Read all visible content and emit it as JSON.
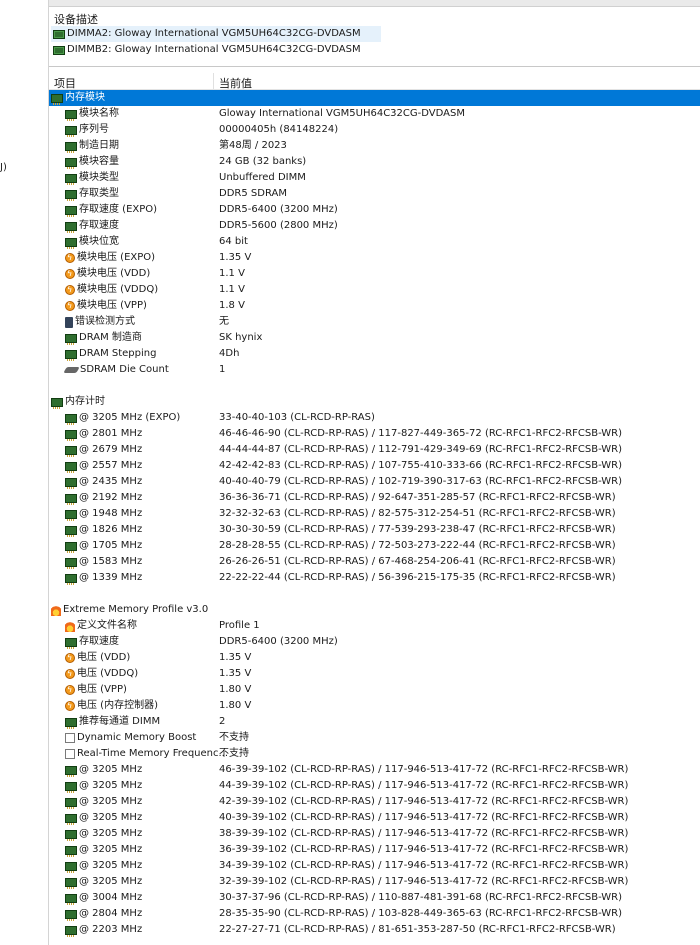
{
  "left_fragment": "J)",
  "device_panel": {
    "title": "设备描述",
    "items": [
      {
        "label": "DIMMA2: Gloway International VGM5UH64C32CG-DVDASM"
      },
      {
        "label": "DIMMB2: Gloway International VGM5UH64C32CG-DVDASM"
      }
    ]
  },
  "columns": {
    "field": "项目",
    "value": "当前值"
  },
  "rows": [
    {
      "group": true,
      "selected": true,
      "icon": "memory-module-icon",
      "label": "内存模块"
    },
    {
      "icon": "memory-module-icon",
      "label": "模块名称",
      "value": "Gloway International VGM5UH64C32CG-DVDASM"
    },
    {
      "icon": "memory-module-icon",
      "label": "序列号",
      "value": "00000405h (84148224)"
    },
    {
      "icon": "memory-module-icon",
      "label": "制造日期",
      "value": "第48周 / 2023"
    },
    {
      "icon": "memory-module-icon",
      "label": "模块容量",
      "value": "24 GB (32 banks)"
    },
    {
      "icon": "memory-module-icon",
      "label": "模块类型",
      "value": "Unbuffered DIMM"
    },
    {
      "icon": "memory-module-icon",
      "label": "存取类型",
      "value": "DDR5 SDRAM"
    },
    {
      "icon": "memory-module-icon",
      "label": "存取速度 (EXPO)",
      "value": "DDR5-6400 (3200 MHz)"
    },
    {
      "icon": "memory-module-icon",
      "label": "存取速度",
      "value": "DDR5-5600 (2800 MHz)"
    },
    {
      "icon": "memory-module-icon",
      "label": "模块位宽",
      "value": "64 bit"
    },
    {
      "icon": "voltage-icon",
      "label": "模块电压 (EXPO)",
      "value": "1.35 V"
    },
    {
      "icon": "voltage-icon",
      "label": "模块电压 (VDD)",
      "value": "1.1 V"
    },
    {
      "icon": "voltage-icon",
      "label": "模块电压 (VDDQ)",
      "value": "1.1 V"
    },
    {
      "icon": "voltage-icon",
      "label": "模块电压 (VPP)",
      "value": "1.8 V"
    },
    {
      "icon": "ecc-icon",
      "label": "错误检测方式",
      "value": "无"
    },
    {
      "icon": "memory-module-icon",
      "label": "DRAM 制造商",
      "value": "SK hynix"
    },
    {
      "icon": "memory-module-icon",
      "label": "DRAM Stepping",
      "value": "4Dh"
    },
    {
      "icon": "sdram-die-icon",
      "label": "SDRAM Die Count",
      "value": "1"
    },
    {
      "empty": true
    },
    {
      "group": true,
      "icon": "memory-timing-icon",
      "label": "内存计时"
    },
    {
      "icon": "memory-module-icon",
      "label": "@ 3205 MHz (EXPO)",
      "value": "33-40-40-103  (CL-RCD-RP-RAS)"
    },
    {
      "icon": "memory-module-icon",
      "label": "@ 2801 MHz",
      "value": "46-46-46-90  (CL-RCD-RP-RAS) / 117-827-449-365-72  (RC-RFC1-RFC2-RFCSB-WR)"
    },
    {
      "icon": "memory-module-icon",
      "label": "@ 2679 MHz",
      "value": "44-44-44-87  (CL-RCD-RP-RAS) / 112-791-429-349-69  (RC-RFC1-RFC2-RFCSB-WR)"
    },
    {
      "icon": "memory-module-icon",
      "label": "@ 2557 MHz",
      "value": "42-42-42-83  (CL-RCD-RP-RAS) / 107-755-410-333-66  (RC-RFC1-RFC2-RFCSB-WR)"
    },
    {
      "icon": "memory-module-icon",
      "label": "@ 2435 MHz",
      "value": "40-40-40-79  (CL-RCD-RP-RAS) / 102-719-390-317-63  (RC-RFC1-RFC2-RFCSB-WR)"
    },
    {
      "icon": "memory-module-icon",
      "label": "@ 2192 MHz",
      "value": "36-36-36-71  (CL-RCD-RP-RAS) / 92-647-351-285-57  (RC-RFC1-RFC2-RFCSB-WR)"
    },
    {
      "icon": "memory-module-icon",
      "label": "@ 1948 MHz",
      "value": "32-32-32-63  (CL-RCD-RP-RAS) / 82-575-312-254-51  (RC-RFC1-RFC2-RFCSB-WR)"
    },
    {
      "icon": "memory-module-icon",
      "label": "@ 1826 MHz",
      "value": "30-30-30-59  (CL-RCD-RP-RAS) / 77-539-293-238-47  (RC-RFC1-RFC2-RFCSB-WR)"
    },
    {
      "icon": "memory-module-icon",
      "label": "@ 1705 MHz",
      "value": "28-28-28-55  (CL-RCD-RP-RAS) / 72-503-273-222-44  (RC-RFC1-RFC2-RFCSB-WR)"
    },
    {
      "icon": "memory-module-icon",
      "label": "@ 1583 MHz",
      "value": "26-26-26-51  (CL-RCD-RP-RAS) / 67-468-254-206-41  (RC-RFC1-RFC2-RFCSB-WR)"
    },
    {
      "icon": "memory-module-icon",
      "label": "@ 1339 MHz",
      "value": "22-22-22-44  (CL-RCD-RP-RAS) / 56-396-215-175-35  (RC-RFC1-RFC2-RFCSB-WR)"
    },
    {
      "empty": true
    },
    {
      "group": true,
      "icon": "fire-icon",
      "label": "Extreme Memory Profile v3.0"
    },
    {
      "icon": "fire-icon",
      "label": "定义文件名称",
      "value": "Profile 1"
    },
    {
      "icon": "memory-module-icon",
      "label": "存取速度",
      "value": "DDR5-6400 (3200 MHz)"
    },
    {
      "icon": "voltage-icon",
      "label": "电压 (VDD)",
      "value": "1.35 V"
    },
    {
      "icon": "voltage-icon",
      "label": "电压 (VDDQ)",
      "value": "1.35 V"
    },
    {
      "icon": "voltage-icon",
      "label": "电压 (VPP)",
      "value": "1.80 V"
    },
    {
      "icon": "voltage-icon",
      "label": "电压 (内存控制器)",
      "value": "1.80 V"
    },
    {
      "icon": "memory-module-icon",
      "label": "推荐每通道 DIMM",
      "value": "2"
    },
    {
      "icon": "checkbox-icon",
      "label": "Dynamic Memory Boost",
      "value": "不支持"
    },
    {
      "icon": "checkbox-icon",
      "label": "Real-Time Memory Frequenc...",
      "value": "不支持"
    },
    {
      "icon": "memory-module-icon",
      "label": "@ 3205 MHz",
      "value": "46-39-39-102  (CL-RCD-RP-RAS) / 117-946-513-417-72  (RC-RFC1-RFC2-RFCSB-WR)"
    },
    {
      "icon": "memory-module-icon",
      "label": "@ 3205 MHz",
      "value": "44-39-39-102  (CL-RCD-RP-RAS) / 117-946-513-417-72  (RC-RFC1-RFC2-RFCSB-WR)"
    },
    {
      "icon": "memory-module-icon",
      "label": "@ 3205 MHz",
      "value": "42-39-39-102  (CL-RCD-RP-RAS) / 117-946-513-417-72  (RC-RFC1-RFC2-RFCSB-WR)"
    },
    {
      "icon": "memory-module-icon",
      "label": "@ 3205 MHz",
      "value": "40-39-39-102  (CL-RCD-RP-RAS) / 117-946-513-417-72  (RC-RFC1-RFC2-RFCSB-WR)"
    },
    {
      "icon": "memory-module-icon",
      "label": "@ 3205 MHz",
      "value": "38-39-39-102  (CL-RCD-RP-RAS) / 117-946-513-417-72  (RC-RFC1-RFC2-RFCSB-WR)"
    },
    {
      "icon": "memory-module-icon",
      "label": "@ 3205 MHz",
      "value": "36-39-39-102  (CL-RCD-RP-RAS) / 117-946-513-417-72  (RC-RFC1-RFC2-RFCSB-WR)"
    },
    {
      "icon": "memory-module-icon",
      "label": "@ 3205 MHz",
      "value": "34-39-39-102  (CL-RCD-RP-RAS) / 117-946-513-417-72  (RC-RFC1-RFC2-RFCSB-WR)"
    },
    {
      "icon": "memory-module-icon",
      "label": "@ 3205 MHz",
      "value": "32-39-39-102  (CL-RCD-RP-RAS) / 117-946-513-417-72  (RC-RFC1-RFC2-RFCSB-WR)"
    },
    {
      "icon": "memory-module-icon",
      "label": "@ 3004 MHz",
      "value": "30-37-37-96  (CL-RCD-RP-RAS) / 110-887-481-391-68  (RC-RFC1-RFC2-RFCSB-WR)"
    },
    {
      "icon": "memory-module-icon",
      "label": "@ 2804 MHz",
      "value": "28-35-35-90  (CL-RCD-RP-RAS) / 103-828-449-365-63  (RC-RFC1-RFC2-RFCSB-WR)"
    },
    {
      "icon": "memory-module-icon",
      "label": "@ 2203 MHz",
      "value": "22-27-27-71  (CL-RCD-RP-RAS) / 81-651-353-287-50  (RC-RFC1-RFC2-RFCSB-WR)"
    }
  ]
}
